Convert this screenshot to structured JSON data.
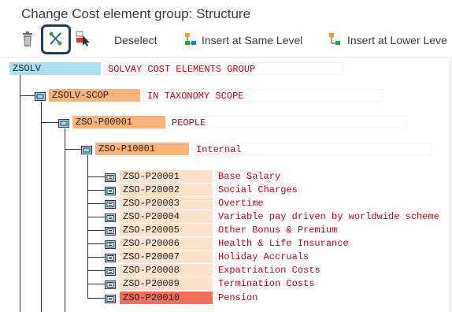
{
  "window": {
    "title": "Change Cost element group: Structure"
  },
  "toolbar": {
    "delete_icon": "trash-icon",
    "cut_icon": "scissors-cut-icon",
    "select_icon": "select-cursor-icon",
    "deselect_label": "Deselect",
    "insert_same_label": "Insert at Same Level",
    "insert_lower_label": "Insert at Lower Leve"
  },
  "colors": {
    "root_code_bg": "#a9e0f2",
    "group_code_bg": "#f8b27a",
    "leaf_code_bg": "#fbe2c8",
    "selected_code_bg": "#f26d5b",
    "description_text": "#c0001b",
    "highlight_border": "#1f3864"
  },
  "tree": {
    "root": {
      "code": "ZSOLV",
      "description": "SOLVAY COST ELEMENTS GROUP"
    },
    "level1": {
      "code": "ZSOLV-SCOP",
      "description": "IN TAXONOMY SCOPE"
    },
    "level2": {
      "code": "ZSO-P00001",
      "description": "PEOPLE"
    },
    "level3": {
      "code": "ZSO-P10001",
      "description": "Internal"
    },
    "leaves": [
      {
        "code": "ZSO-P20001",
        "description": "Base Salary"
      },
      {
        "code": "ZSO-P20002",
        "description": "Social Charges"
      },
      {
        "code": "ZSO-P20003",
        "description": "Overtime"
      },
      {
        "code": "ZSO-P20004",
        "description": "Variable pay driven by worldwide scheme"
      },
      {
        "code": "ZSO-P20005",
        "description": "Other Bonus & Premium"
      },
      {
        "code": "ZSO-P20006",
        "description": "Health & Life Insurance"
      },
      {
        "code": "ZSO-P20007",
        "description": "Holiday Accruals"
      },
      {
        "code": "ZSO-P20008",
        "description": "Expatriation Costs"
      },
      {
        "code": "ZSO-P20009",
        "description": "Termination Costs"
      },
      {
        "code": "ZSO-P20010",
        "description": "Pension",
        "selected": true
      }
    ]
  }
}
